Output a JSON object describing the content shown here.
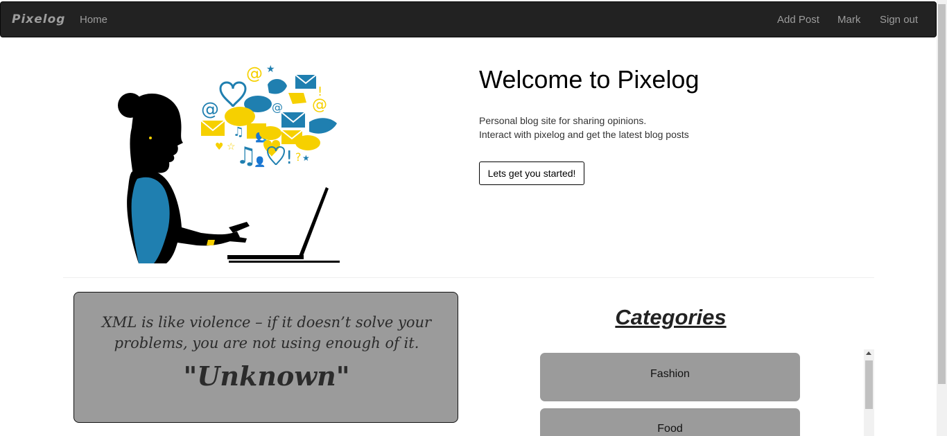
{
  "navbar": {
    "brand": "Pixelog",
    "home": "Home",
    "add_post": "Add Post",
    "mark": "Mark",
    "sign_out": "Sign out"
  },
  "hero": {
    "title": "Welcome to Pixelog",
    "line1": "Personal blog site for sharing opinions.",
    "line2": "Interact with pixelog and get the latest blog posts",
    "button": "Lets get you started!"
  },
  "quote": {
    "text": "XML is like violence – if it doesn’t solve your problems, you are not using enough of it.",
    "author": "\"Unknown\""
  },
  "categories": {
    "title": "Categories",
    "items": [
      "Fashion",
      "Food"
    ]
  },
  "colors": {
    "navbar_bg": "#222222",
    "nav_text": "#9d9d9d",
    "card_bg": "#9b9b9b",
    "accent_blue": "#1f7fb0",
    "accent_yellow": "#f6d000"
  },
  "icons": [
    "woman-laptop-illustration",
    "social-icons-cloud"
  ]
}
